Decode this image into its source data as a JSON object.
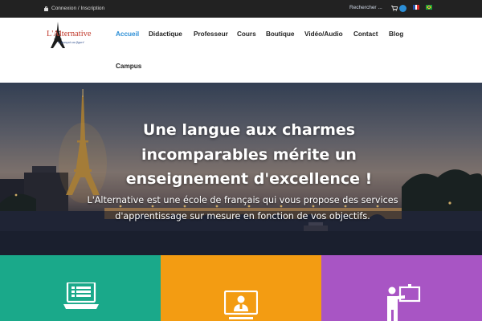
{
  "topbar": {
    "login_label": "Connexion / Inscription",
    "search_placeholder": "Rechercher ...",
    "cart_icon": "cart-icon",
    "languages": [
      "fr",
      "pt-br"
    ]
  },
  "header": {
    "logo_text": "L'Alternative",
    "logo_tagline": "le français au figuré",
    "nav": [
      {
        "label": "Accueil",
        "active": true
      },
      {
        "label": "Didactique"
      },
      {
        "label": "Professeur"
      },
      {
        "label": "Cours"
      },
      {
        "label": "Boutique"
      },
      {
        "label": "Vidéo/Audio"
      },
      {
        "label": "Contact"
      },
      {
        "label": "Blog"
      },
      {
        "label": "Campus"
      }
    ]
  },
  "hero": {
    "title": "Une langue aux charmes incomparables mérite un enseignement d'excellence !",
    "subtitle": "L'Alternative est une école de français qui vous propose des services d'apprentissage sur mesure en fonction de vos objectifs."
  },
  "tiles": [
    {
      "icon": "laptop-icon",
      "color": "#1aa98a"
    },
    {
      "icon": "video-teacher-icon",
      "color": "#f39c12"
    },
    {
      "icon": "presenter-icon",
      "color": "#a855c4"
    }
  ],
  "colors": {
    "accent": "#2b8ed6",
    "topbar": "#222222"
  }
}
